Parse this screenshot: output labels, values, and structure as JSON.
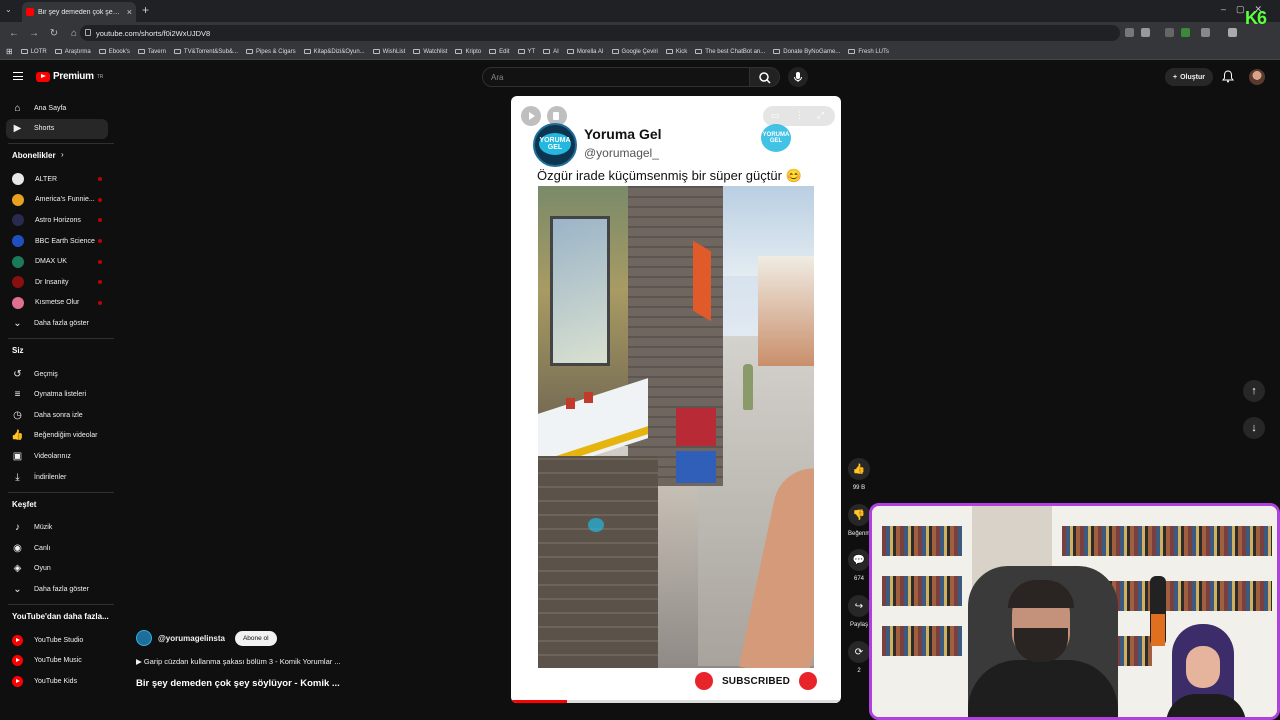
{
  "browser": {
    "tab_title": "Bir şey demeden çok şey söylü...",
    "url": "youtube.com/shorts/f0i2WxUJDV8",
    "bookmarks": [
      "LOTR",
      "Araştırma",
      "Ebook's",
      "Tavern",
      "TV&Torrent&Sub&...",
      "Pipes & Cigars",
      "Kitap&Dizi&Oyun...",
      "WishList",
      "Watchlist",
      "Kripto",
      "Edit",
      "YT",
      "AI",
      "Morella AI",
      "Google Çeviri",
      "Kick",
      "The best ChatBot an...",
      "Donate ByNoGame...",
      "Fresh LUTs"
    ],
    "overlay_logo": "K6"
  },
  "header": {
    "logo_text": "Premium",
    "logo_badge": "TR",
    "search_placeholder": "Ara",
    "create_label": "Oluştur"
  },
  "sidebar": {
    "main": [
      {
        "label": "Ana Sayfa",
        "icon": "home-icon"
      },
      {
        "label": "Shorts",
        "icon": "shorts-icon",
        "active": true
      }
    ],
    "subscriptions_title": "Abonelikler",
    "subscriptions": [
      {
        "label": "ALTER",
        "color": "#e8e8e8"
      },
      {
        "label": "America's Funnie...",
        "color": "#e8a020"
      },
      {
        "label": "Astro Horizons",
        "color": "#2a2a50"
      },
      {
        "label": "BBC Earth Science",
        "color": "#2050c0"
      },
      {
        "label": "DMAX UK",
        "color": "#1a7a5a"
      },
      {
        "label": "Dr Insanity",
        "color": "#8a1010"
      },
      {
        "label": "Kısmetse Olur",
        "color": "#e07090"
      }
    ],
    "show_more": "Daha fazla göster",
    "you_title": "Siz",
    "you_items": [
      {
        "label": "Geçmiş",
        "icon": "history-icon"
      },
      {
        "label": "Oynatma listeleri",
        "icon": "playlists-icon"
      },
      {
        "label": "Daha sonra izle",
        "icon": "watch-later-icon"
      },
      {
        "label": "Beğendiğim videolar",
        "icon": "liked-videos-icon"
      },
      {
        "label": "Videolarınız",
        "icon": "your-videos-icon"
      },
      {
        "label": "İndirilenler",
        "icon": "downloads-icon"
      }
    ],
    "explore_title": "Keşfet",
    "explore_items": [
      {
        "label": "Müzik",
        "icon": "music-icon"
      },
      {
        "label": "Canlı",
        "icon": "live-icon"
      },
      {
        "label": "Oyun",
        "icon": "gaming-icon"
      }
    ],
    "explore_show_more": "Daha fazla göster",
    "more_title": "YouTube'dan daha fazla...",
    "more_items": [
      "YouTube Studio",
      "YouTube Music",
      "YouTube Kids"
    ]
  },
  "short": {
    "channel_name": "Yoruma Gel",
    "channel_handle": "@yorumagel_",
    "logo_text": "YORUMA GEL",
    "caption": "Özgür irade küçümsenmiş bir süper güçtür 😊",
    "subscribed_label": "SUBSCRIBED",
    "progress": 0.17,
    "uploader": "@yorumagelinsta",
    "subscribe_button": "Abone ol",
    "playlist": "▶ Garip cüzdan kullanma şakası bölüm 3 - Komik Yorumlar ...",
    "title": "Bir şey demeden çok şey söylüyor - Komik ..."
  },
  "actions": [
    {
      "name": "like",
      "icon": "thumbs-up-icon",
      "glyph": "👍",
      "count": "99 B"
    },
    {
      "name": "dislike",
      "icon": "thumbs-down-icon",
      "glyph": "👎",
      "count": "Beğenm"
    },
    {
      "name": "comments",
      "icon": "comment-icon",
      "glyph": "💬",
      "count": "674"
    },
    {
      "name": "share",
      "icon": "share-icon",
      "glyph": "↪",
      "count": "Paylaş"
    },
    {
      "name": "remix",
      "icon": "remix-icon",
      "glyph": "⟳",
      "count": "2"
    }
  ],
  "colors": {
    "accent": "#ff0000",
    "cam_border": "#b040e0"
  }
}
